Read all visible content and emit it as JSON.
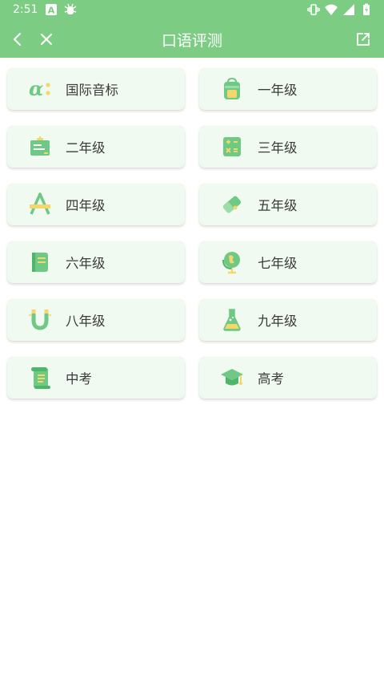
{
  "status_bar": {
    "time": "2:51",
    "icons": [
      "a-icon",
      "notification-bug-icon",
      "vibrate-icon",
      "wifi-icon",
      "signal-icon",
      "battery-icon"
    ]
  },
  "toolbar": {
    "title": "口语评测",
    "back_icon": "chevron-left-icon",
    "close_icon": "close-icon",
    "share_icon": "share-icon"
  },
  "colors": {
    "primary": "#7ccd83",
    "card_bg": "#f1faf1",
    "icon_green": "#6dc984",
    "icon_yellow": "#f4d66b",
    "text": "#3c3c3c"
  },
  "categories": [
    {
      "label": "国际音标",
      "icon": "alpha-symbol-icon"
    },
    {
      "label": "一年级",
      "icon": "backpack-icon"
    },
    {
      "label": "二年级",
      "icon": "blackboard-icon"
    },
    {
      "label": "三年级",
      "icon": "calculator-icon"
    },
    {
      "label": "四年级",
      "icon": "letter-a-icon"
    },
    {
      "label": "五年级",
      "icon": "eraser-icon"
    },
    {
      "label": "六年级",
      "icon": "notebook-icon"
    },
    {
      "label": "七年级",
      "icon": "globe-icon"
    },
    {
      "label": "八年级",
      "icon": "magnet-icon"
    },
    {
      "label": "九年级",
      "icon": "flask-icon"
    },
    {
      "label": "中考",
      "icon": "scroll-icon"
    },
    {
      "label": "高考",
      "icon": "graduation-cap-icon"
    }
  ]
}
